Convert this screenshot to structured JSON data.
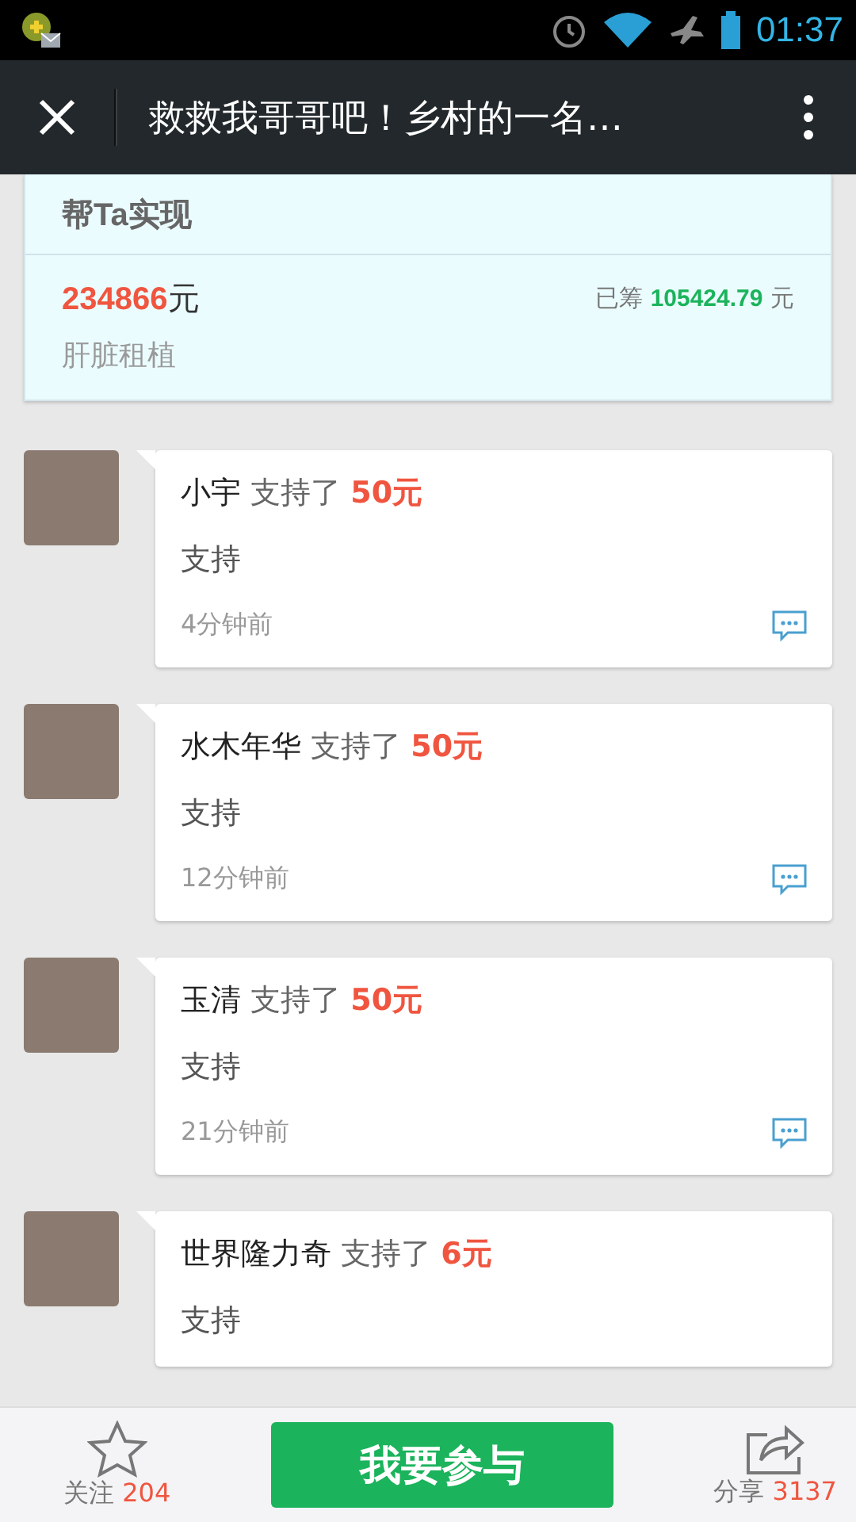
{
  "status_bar": {
    "time": "01:37"
  },
  "header": {
    "title": "救救我哥哥吧！乡村的一名…"
  },
  "project": {
    "heading": "帮Ta实现",
    "target_amount": "234866",
    "target_unit": "元",
    "raised_label": "已筹",
    "raised_amount": "105424.79",
    "raised_unit": "元",
    "purpose": "肝脏租植"
  },
  "supporters": [
    {
      "name": "小宇",
      "action": "支持了",
      "amount": "50元",
      "message": "支持",
      "time": "4分钟前"
    },
    {
      "name": "水木年华",
      "action": "支持了",
      "amount": "50元",
      "message": "支持",
      "time": "12分钟前"
    },
    {
      "name": "玉清",
      "action": "支持了",
      "amount": "50元",
      "message": "支持",
      "time": "21分钟前"
    },
    {
      "name": "世界隆力奇",
      "action": "支持了",
      "amount": "6元",
      "message": "支持"
    }
  ],
  "bottom_bar": {
    "follow_label": "关注",
    "follow_count": "204",
    "join_button": "我要参与",
    "share_label": "分享",
    "share_count": "3137"
  }
}
